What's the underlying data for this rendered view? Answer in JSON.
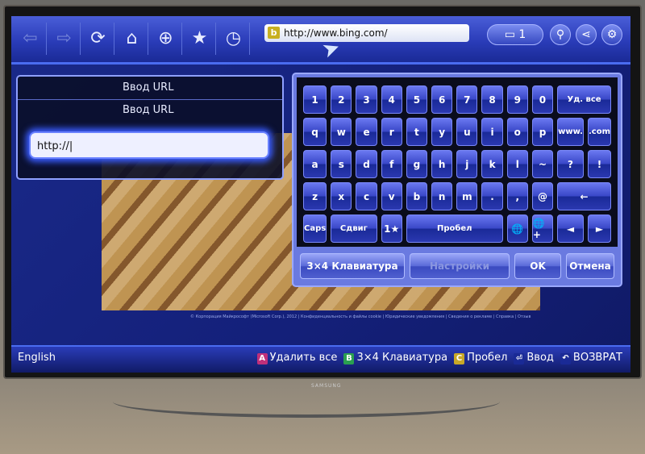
{
  "toolbar": {
    "buttons": [
      {
        "icon": "back-arrow-icon",
        "glyph": "⇦"
      },
      {
        "icon": "forward-arrow-icon",
        "glyph": "⇨"
      },
      {
        "icon": "refresh-icon",
        "glyph": "⟳"
      },
      {
        "icon": "home-icon",
        "glyph": "⌂"
      },
      {
        "icon": "zoom-icon",
        "glyph": "⊕"
      },
      {
        "icon": "star-icon",
        "glyph": "★"
      },
      {
        "icon": "history-icon",
        "glyph": "◷"
      }
    ],
    "url": "http://www.bing.com/",
    "tab_count": "1",
    "search_glyph": "⚲",
    "share_glyph": "⋖",
    "settings_glyph": "⚙"
  },
  "url_panel": {
    "title": "Ввод URL",
    "label": "Ввод URL",
    "input_value": "http://"
  },
  "keyboard": {
    "rows": [
      [
        "1",
        "2",
        "3",
        "4",
        "5",
        "6",
        "7",
        "8",
        "9",
        "0",
        "Уд. все"
      ],
      [
        "q",
        "w",
        "e",
        "r",
        "t",
        "y",
        "u",
        "i",
        "o",
        "p",
        "www.",
        ".com"
      ],
      [
        "a",
        "s",
        "d",
        "f",
        "g",
        "h",
        "j",
        "k",
        "l",
        "~",
        "?",
        "!"
      ],
      [
        "z",
        "x",
        "c",
        "v",
        "b",
        "n",
        "m",
        ".",
        ",",
        "@",
        "←"
      ],
      [
        "Caps",
        "Сдвиг",
        "1★",
        "Пробел",
        "🌐",
        "🌐+",
        "◄",
        "►"
      ]
    ],
    "buttons": [
      "3×4 Клавиатура",
      "Настройки",
      "OK",
      "Отмена"
    ]
  },
  "web_footer": "© Корпорация Майкрософт (Microsoft Corp.), 2012 | Конфиденциальность и файлы cookie | Юридические уведомления | Сведения о рекламе | Справка | Отзыв",
  "bottom_bar": {
    "language": "English",
    "hints": [
      {
        "key": "A",
        "label": "Удалить все",
        "color": "#c0307a"
      },
      {
        "key": "B",
        "label": "3×4 Клавиатура",
        "color": "#2aa050"
      },
      {
        "key": "C",
        "label": "Пробел",
        "color": "#c8a828"
      },
      {
        "key": "⏎",
        "label": "Ввод",
        "color": "#1a2a96"
      },
      {
        "key": "↶",
        "label": "ВОЗВРАТ",
        "color": "#1a2a96"
      }
    ]
  },
  "tv_brand": "SAMSUNG"
}
